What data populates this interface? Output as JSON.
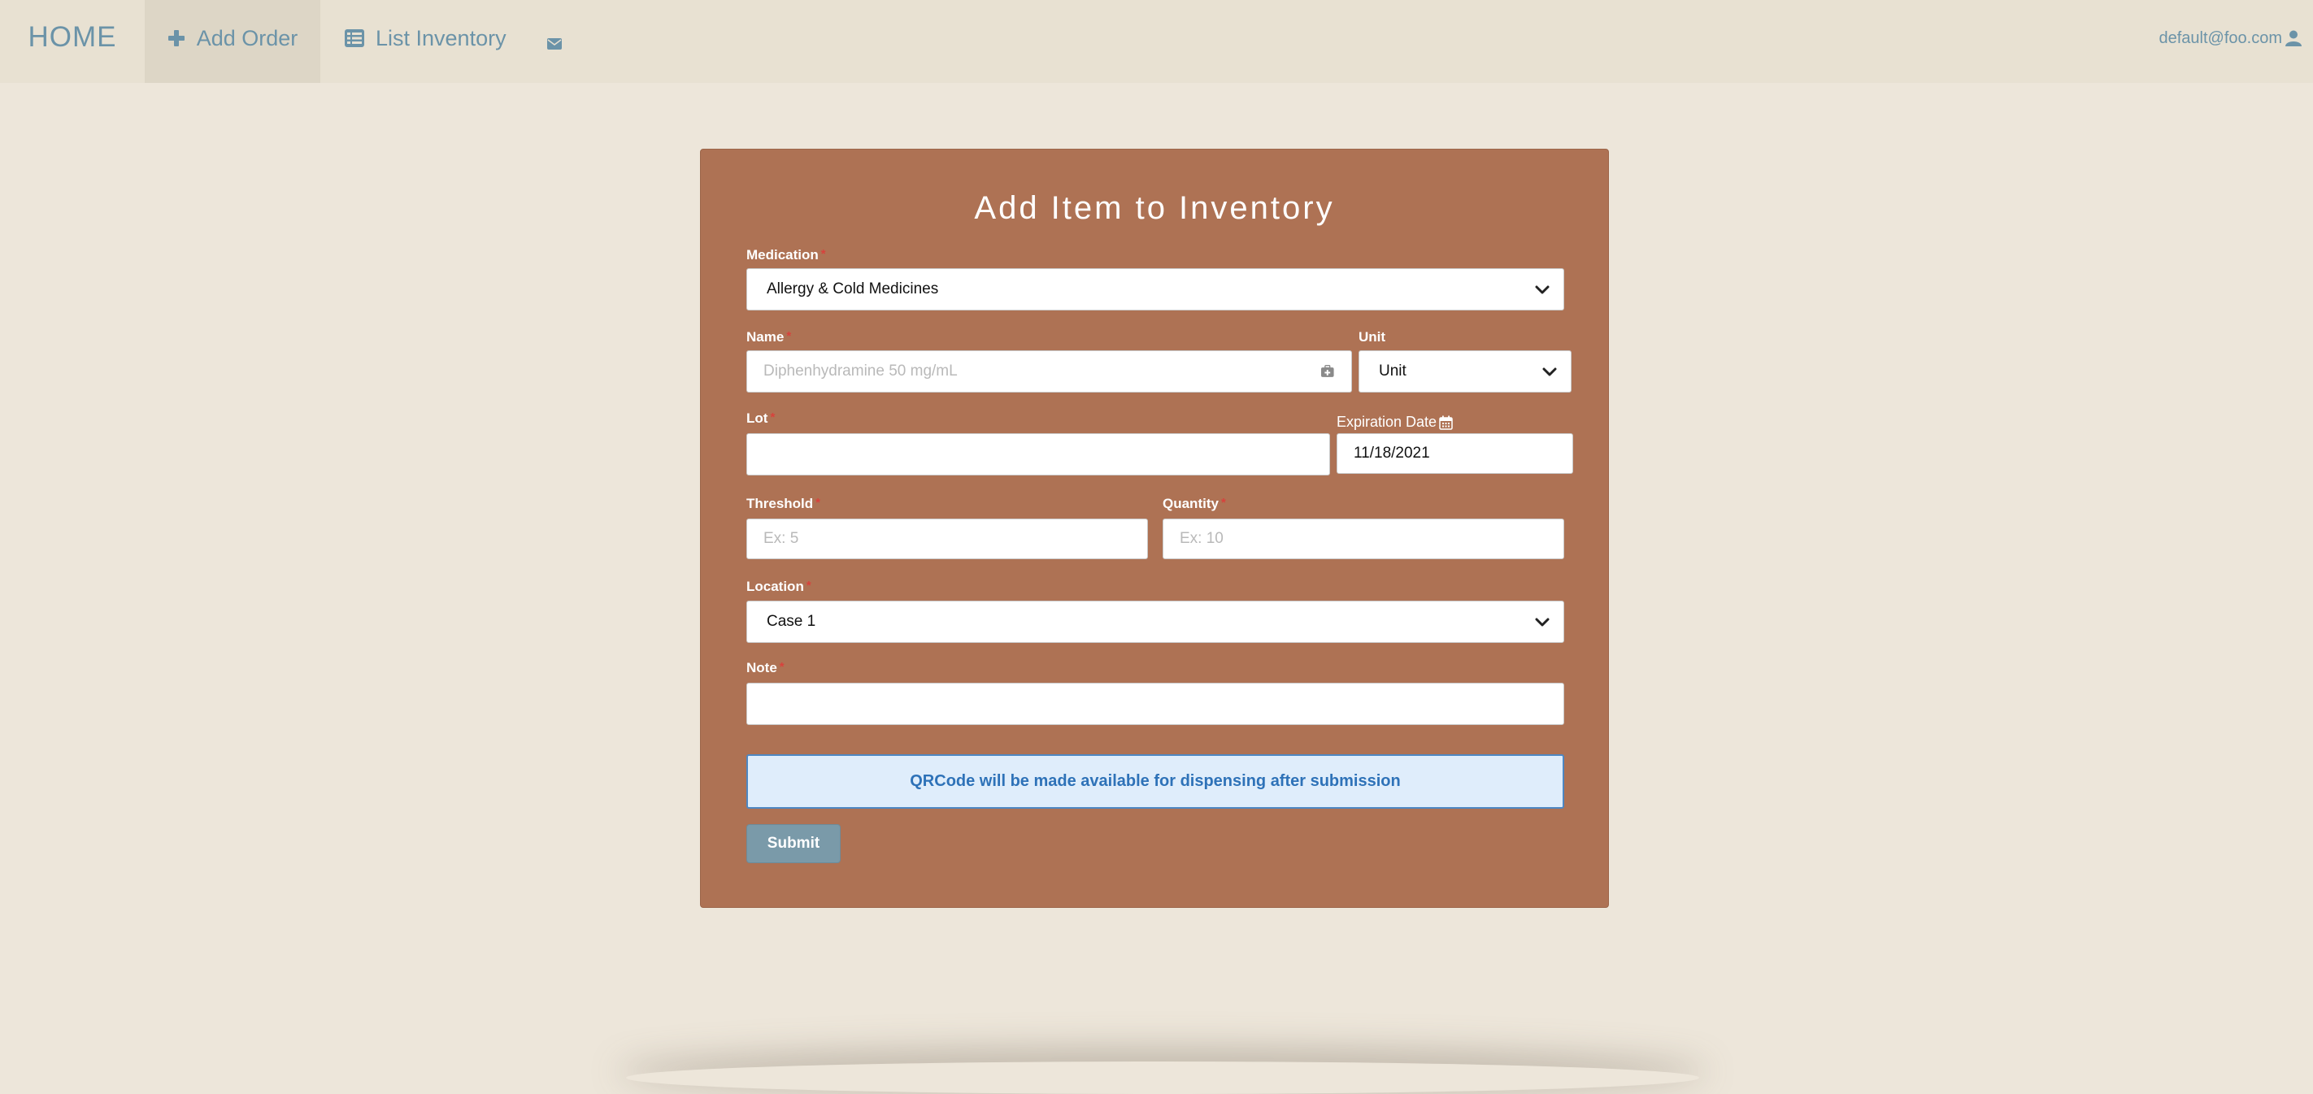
{
  "nav": {
    "brand": "HOME",
    "add_order": "Add Order",
    "list_inventory": "List Inventory",
    "user_email": "default@foo.com"
  },
  "form": {
    "title": "Add Item to Inventory",
    "medication": {
      "label": "Medication",
      "value": "Allergy & Cold Medicines"
    },
    "name": {
      "label": "Name",
      "placeholder": "Diphenhydramine 50 mg/mL"
    },
    "unit": {
      "label": "Unit",
      "value": "Unit"
    },
    "lot": {
      "label": "Lot",
      "value": ""
    },
    "expiration": {
      "label": "Expiration Date",
      "value": "11/18/2021"
    },
    "threshold": {
      "label": "Threshold",
      "placeholder": "Ex: 5"
    },
    "quantity": {
      "label": "Quantity",
      "placeholder": "Ex: 10"
    },
    "location": {
      "label": "Location",
      "value": "Case 1"
    },
    "note": {
      "label": "Note",
      "value": ""
    },
    "required_marker": "*",
    "notice": "QRCode will be made available for dispensing after submission",
    "submit_label": "Submit"
  },
  "colors": {
    "background": "#ede6da",
    "navbar": "#e8e1d2",
    "nav_text": "#6b93a8",
    "card": "#ae7254",
    "notice_bg": "#dfedfb",
    "notice_text": "#2e72b8",
    "submit_bg": "#7a9aa9",
    "required": "#d9413c"
  },
  "icons": {
    "add_order": "plus-icon",
    "list_inventory": "list-icon",
    "mail": "envelope-icon",
    "user": "user-icon",
    "name_field": "medkit-icon",
    "expiration": "calendar-icon",
    "select": "chevron-down-icon"
  }
}
